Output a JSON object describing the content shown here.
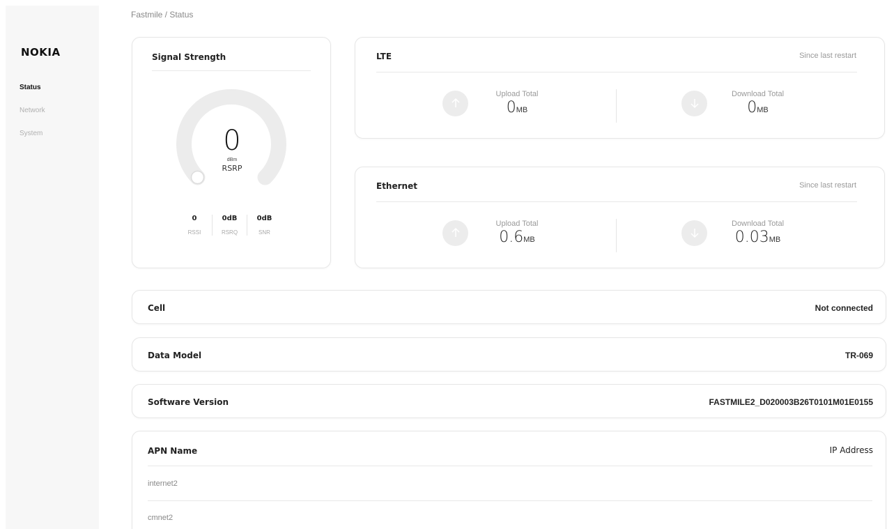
{
  "sidebar": {
    "logo": "NOKIA",
    "items": [
      {
        "label": "Status",
        "active": true
      },
      {
        "label": "Network",
        "active": false
      },
      {
        "label": "System",
        "active": false
      }
    ]
  },
  "breadcrumb": "Fastmile / Status",
  "signal": {
    "title": "Signal Strength",
    "value": "0",
    "unit": "dBm",
    "label": "RSRP",
    "level_fraction": 0,
    "metrics": [
      {
        "value": "0",
        "label": "RSSI"
      },
      {
        "value": "0dB",
        "label": "RSRQ"
      },
      {
        "value": "0dB",
        "label": "SNR"
      }
    ]
  },
  "lte": {
    "title": "LTE",
    "since": "Since last restart",
    "upload_label": "Upload Total",
    "upload_value": "0",
    "upload_unit": "MB",
    "download_label": "Download Total",
    "download_value": "0",
    "download_unit": "MB"
  },
  "ethernet": {
    "title": "Ethernet",
    "since": "Since last restart",
    "upload_label": "Upload Total",
    "upload_value": "0.6",
    "upload_unit": "MB",
    "download_label": "Download Total",
    "download_value": "0.03",
    "download_unit": "MB"
  },
  "cell": {
    "title": "Cell",
    "value": "Not connected"
  },
  "data_model": {
    "title": "Data Model",
    "value": "TR-069"
  },
  "software": {
    "title": "Software Version",
    "value": "FASTMILE2_D020003B26T0101M01E0155"
  },
  "apn": {
    "title": "APN Name",
    "ip_header": "IP Address",
    "rows": [
      {
        "name": "internet2"
      },
      {
        "name": "cmnet2"
      }
    ]
  },
  "colors": {
    "gauge_track": "#ececec",
    "arrow_circle": "#ececec"
  },
  "icons": {
    "upload": "arrow-up-icon",
    "download": "arrow-down-icon"
  }
}
